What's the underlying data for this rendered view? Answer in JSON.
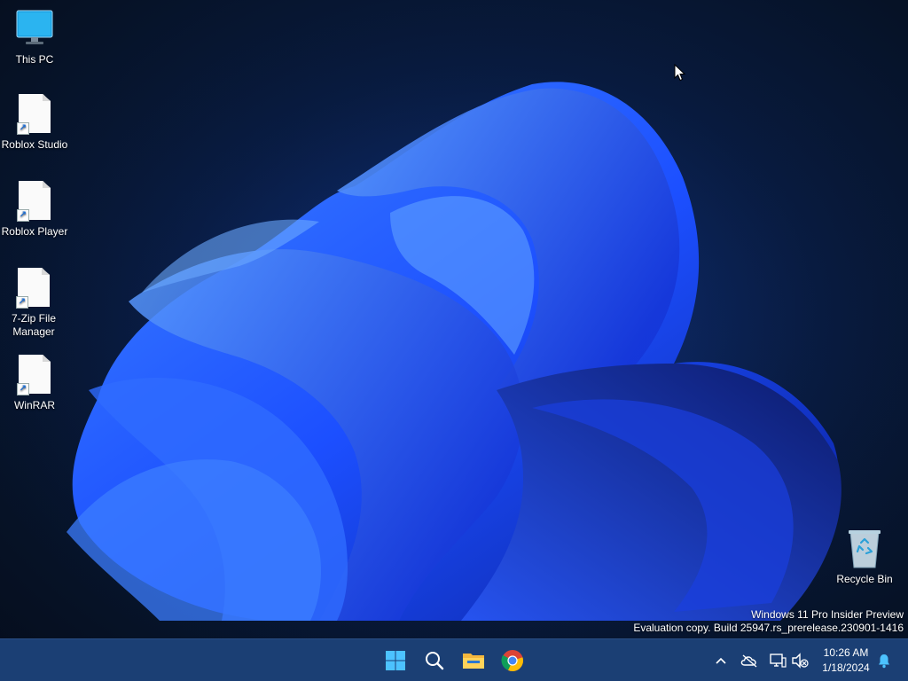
{
  "desktop": {
    "icons": [
      {
        "label": "This PC",
        "icon": "monitor-icon"
      },
      {
        "label": "Roblox Studio",
        "icon": "shortcut-file-icon"
      },
      {
        "label": "Roblox Player",
        "icon": "shortcut-file-icon"
      },
      {
        "label": "7-Zip File Manager",
        "icon": "shortcut-file-icon"
      },
      {
        "label": "WinRAR",
        "icon": "shortcut-file-icon"
      },
      {
        "label": "Recycle Bin",
        "icon": "recycle-bin-icon"
      }
    ],
    "watermark": {
      "line1": "Windows 11 Pro Insider Preview",
      "line2": "Evaluation copy. Build 25947.rs_prerelease.230901-1416"
    }
  },
  "taskbar": {
    "pinned": [
      "windows-start-icon",
      "search-icon",
      "file-explorer-icon",
      "chrome-icon"
    ],
    "tray": [
      "chevron-up-icon",
      "onedrive-offline-icon",
      "network-icon",
      "volume-muted-icon",
      "notification-bell-icon"
    ],
    "clock": {
      "time": "10:26 AM",
      "date": "1/18/2024"
    }
  },
  "colors": {
    "taskbar": "#1b3f74",
    "accent": "#1a6fd8",
    "wallpaper_bloom": "#1f5cff"
  }
}
